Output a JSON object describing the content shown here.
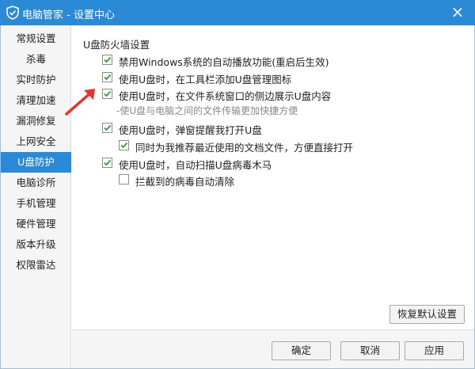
{
  "window": {
    "title": "电脑管家 - 设置中心",
    "accent": "#2a8ad6",
    "icon": "shield-logo-icon",
    "close_icon": "close-icon"
  },
  "sidebar": {
    "items": [
      {
        "label": "常规设置",
        "active": false
      },
      {
        "label": "杀毒",
        "active": false
      },
      {
        "label": "实时防护",
        "active": false
      },
      {
        "label": "清理加速",
        "active": false
      },
      {
        "label": "漏洞修复",
        "active": false
      },
      {
        "label": "上网安全",
        "active": false
      },
      {
        "label": "U盘防护",
        "active": true
      },
      {
        "label": "电脑诊所",
        "active": false
      },
      {
        "label": "手机管理",
        "active": false
      },
      {
        "label": "硬件管理",
        "active": false
      },
      {
        "label": "版本升级",
        "active": false
      },
      {
        "label": "权限雷达",
        "active": false
      }
    ]
  },
  "main": {
    "section_title": "U盘防火墙设置",
    "options": [
      {
        "label": "禁用Windows系统的自动播放功能(重启后生效)",
        "checked": true
      },
      {
        "label": "使用U盘时，在工具栏添加U盘管理图标",
        "checked": true
      },
      {
        "label": "使用U盘时，在文件系统窗口的侧边展示U盘内容",
        "checked": true
      },
      {
        "label": "使用U盘时，弹窗提醒我打开U盘",
        "checked": true
      },
      {
        "label": "同时为我推荐最近使用的文档文件，方便直接打开",
        "checked": true
      },
      {
        "label": "使用U盘时，自动扫描U盘病毒木马",
        "checked": true
      },
      {
        "label": "拦截到的病毒自动清除",
        "checked": false
      }
    ],
    "hint": "-使U盘与电脑之间的文件传输更加快捷方便",
    "restore_label": "恢复默认设置"
  },
  "footer": {
    "ok_label": "确定",
    "cancel_label": "取消",
    "apply_label": "应用"
  },
  "annotation": {
    "arrow_color": "#e8332a",
    "arrow_icon": "red-arrow-icon"
  }
}
